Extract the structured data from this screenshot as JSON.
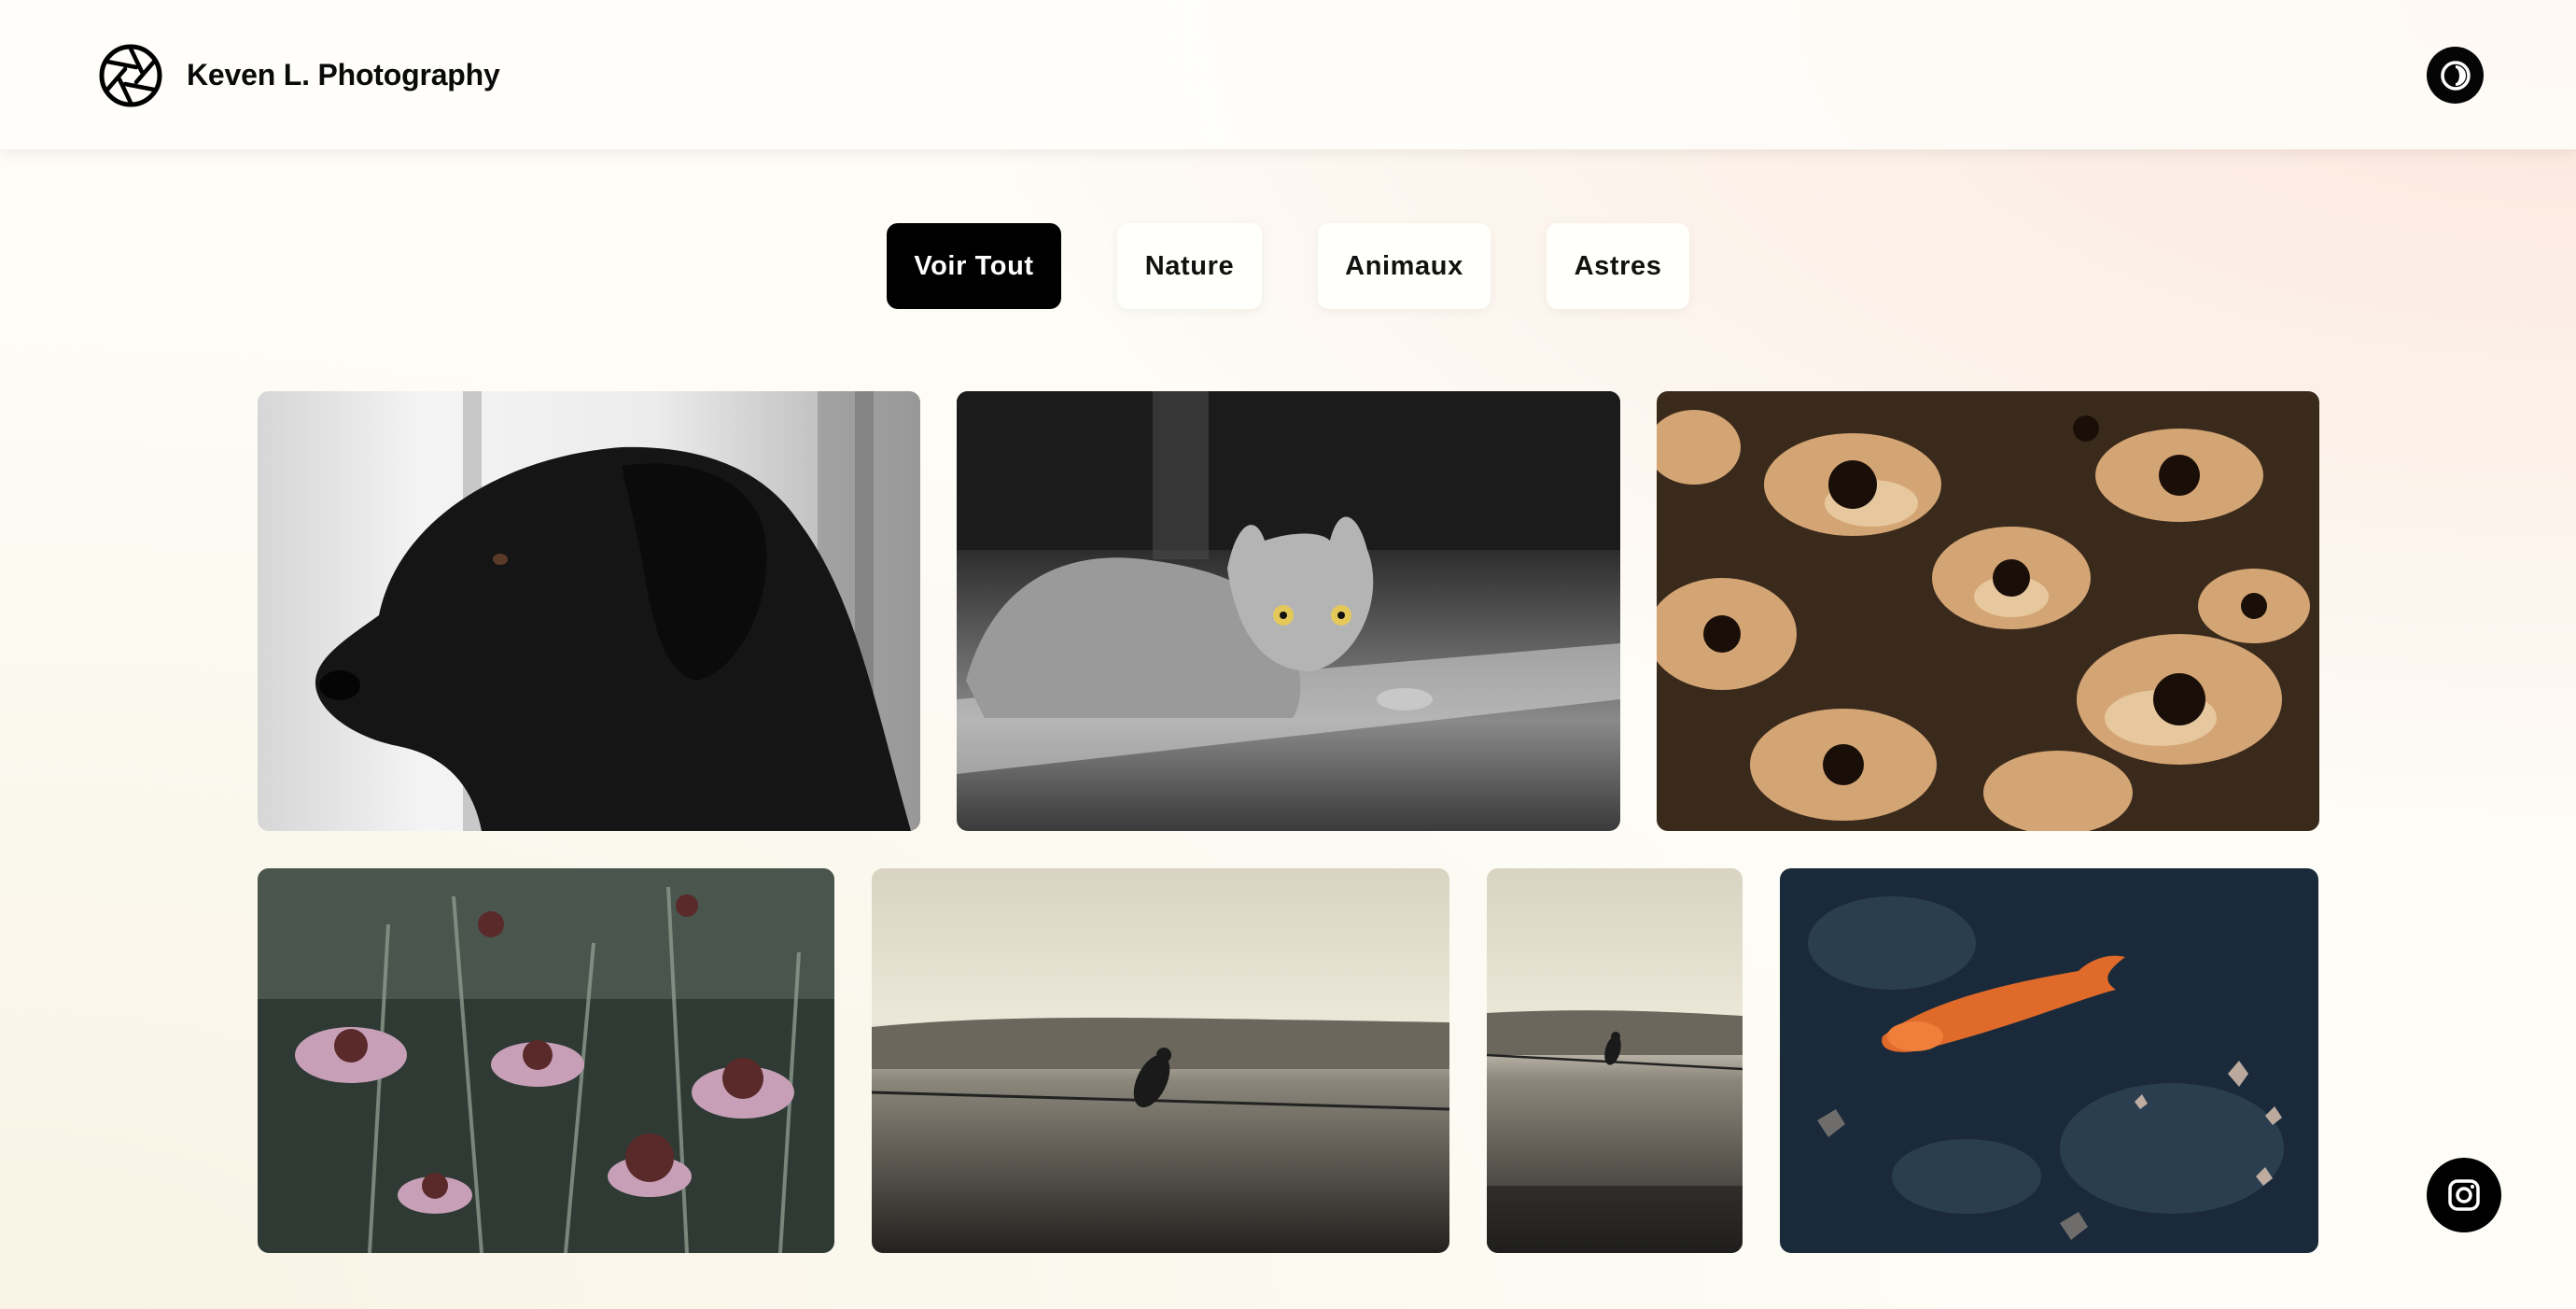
{
  "header": {
    "brand": "Keven L. Photography",
    "logo_icon": "camera-aperture-icon",
    "theme_toggle_icon": "contrast-icon"
  },
  "filters": [
    {
      "label": "Voir Tout",
      "active": true
    },
    {
      "label": "Nature",
      "active": false
    },
    {
      "label": "Animaux",
      "active": false
    },
    {
      "label": "Astres",
      "active": false
    }
  ],
  "gallery": {
    "photos": [
      {
        "subject": "black-dog"
      },
      {
        "subject": "sphynx-cat"
      },
      {
        "subject": "yellow-flowers"
      },
      {
        "subject": "coneflowers"
      },
      {
        "subject": "bird-on-wire"
      },
      {
        "subject": "bird-on-wire-narrow"
      },
      {
        "subject": "koi-fish"
      }
    ]
  },
  "social": {
    "instagram_icon": "instagram-icon"
  },
  "colors": {
    "accent": "#000000",
    "button_bg": "#fffffb",
    "page_bg": "#fdfcf6"
  }
}
